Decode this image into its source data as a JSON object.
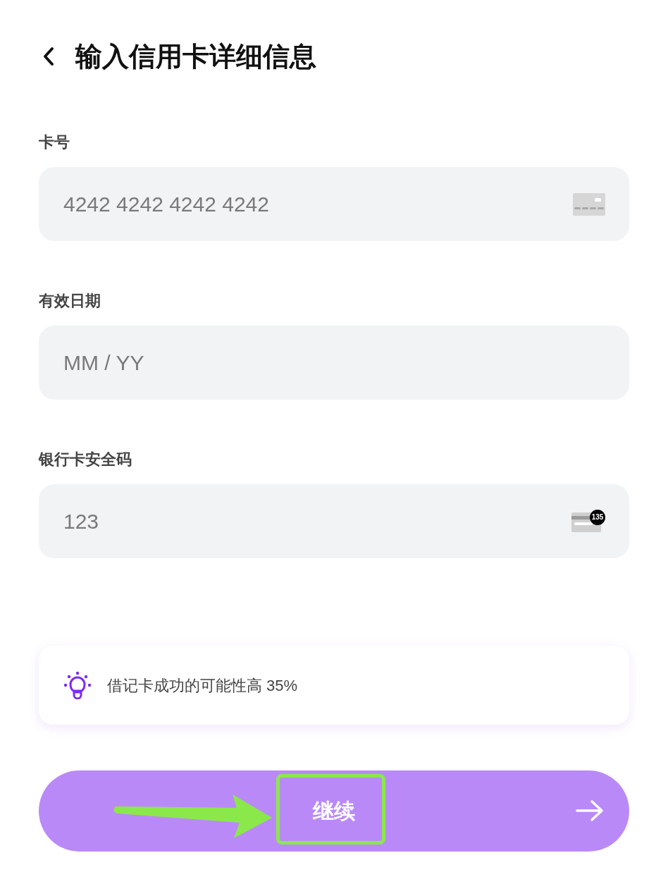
{
  "header": {
    "title": "输入信用卡详细信息"
  },
  "fields": [
    {
      "label": "卡号",
      "placeholder": "4242 4242 4242 4242",
      "icon": {
        "kind": "card"
      }
    },
    {
      "label": "有效日期",
      "placeholder": "MM / YY"
    },
    {
      "label": "银行卡安全码",
      "placeholder": "123",
      "icon": {
        "kind": "cvc",
        "badge": "135"
      }
    }
  ],
  "tip": {
    "text": "借记卡成功的可能性高 35%"
  },
  "continue_button": {
    "label": "继续"
  }
}
